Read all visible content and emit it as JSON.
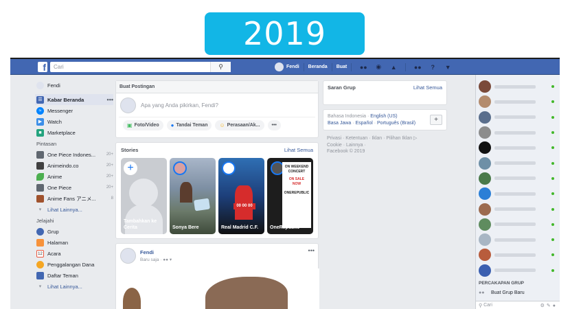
{
  "banner": {
    "year": "2019"
  },
  "topbar": {
    "search_placeholder": "Cari",
    "user": "Fendi",
    "links": [
      "Beranda",
      "Buat"
    ]
  },
  "left_nav": {
    "user": "Fendi",
    "main": [
      {
        "label": "Kabar Beranda",
        "color": "#4267b2",
        "active": true
      },
      {
        "label": "Messenger",
        "color": "#0084ff"
      },
      {
        "label": "Watch",
        "color": "#3b8ee8"
      },
      {
        "label": "Marketplace",
        "color": "#23a37e"
      }
    ],
    "shortcuts_title": "Pintasan",
    "shortcuts": [
      {
        "label": "One Piece Indones...",
        "count": "20+"
      },
      {
        "label": "Animeindo.co",
        "count": "20+"
      },
      {
        "label": "Anime",
        "count": "20+"
      },
      {
        "label": "One Piece",
        "count": "20+"
      },
      {
        "label": "Anime Fans アニメ...",
        "count": "8"
      }
    ],
    "more1": "Lihat Lainnya...",
    "explore_title": "Jelajahi",
    "explore": [
      {
        "label": "Grup",
        "color": "#4267b2"
      },
      {
        "label": "Halaman",
        "color": "#f7923b"
      },
      {
        "label": "Acara",
        "color": "#e9573f"
      },
      {
        "label": "Penggalangan Dana",
        "color": "#f5a623"
      },
      {
        "label": "Daftar Teman",
        "color": "#4267b2"
      }
    ],
    "more2": "Lihat Lainnya..."
  },
  "composer": {
    "title": "Buat Postingan",
    "placeholder": "Apa yang Anda pikirkan, Fendi?",
    "actions": [
      "Foto/Video",
      "Tandai Teman",
      "Perasaan/Ak...",
      "•••"
    ]
  },
  "stories": {
    "title": "Stories",
    "see_all": "Lihat Semua",
    "items": [
      {
        "label": "Tambahkan ke Cerita"
      },
      {
        "label": "Sonya Bere"
      },
      {
        "label": "Real Madrid C.F."
      },
      {
        "label": "OneRepublic"
      }
    ],
    "concert_text": [
      "ON WEEKEND",
      "CONCERT",
      "ON SALE",
      "NOW",
      "ONEREPUBLIC"
    ],
    "score": "00 00 00"
  },
  "post": {
    "author": "Fendi",
    "time": "Baru saja ·"
  },
  "groups_card": {
    "title": "Saran Grup",
    "see_all": "Lihat Semua"
  },
  "languages": {
    "current": "Bahasa Indonesia",
    "links": [
      "English (US)",
      "Basa Jawa",
      "Español",
      "Português (Brasil)"
    ]
  },
  "footer": {
    "line1": "Privasi · Ketentuan · Iklan · Pilihan Iklan ▷",
    "line2": "Cookie · Lainnya ·",
    "line3": "Facebook © 2019"
  },
  "chat": {
    "section": "PERCAKAPAN GRUP",
    "new_group": "Buat Grup Baru",
    "search_placeholder": "Cari",
    "contacts": [
      {
        "color": "#7a4a3a"
      },
      {
        "color": "#b38b6d"
      },
      {
        "color": "#5a6e8c"
      },
      {
        "color": "#8c8c8c"
      },
      {
        "color": "#111111"
      },
      {
        "color": "#6e8fa6"
      },
      {
        "color": "#4a7a4a"
      },
      {
        "color": "#2b7fd6"
      },
      {
        "color": "#9c6b4f"
      },
      {
        "color": "#5f8c5f"
      },
      {
        "color": "#a8b6c4"
      },
      {
        "color": "#b85c3c"
      },
      {
        "color": "#3b5fb0"
      }
    ]
  }
}
